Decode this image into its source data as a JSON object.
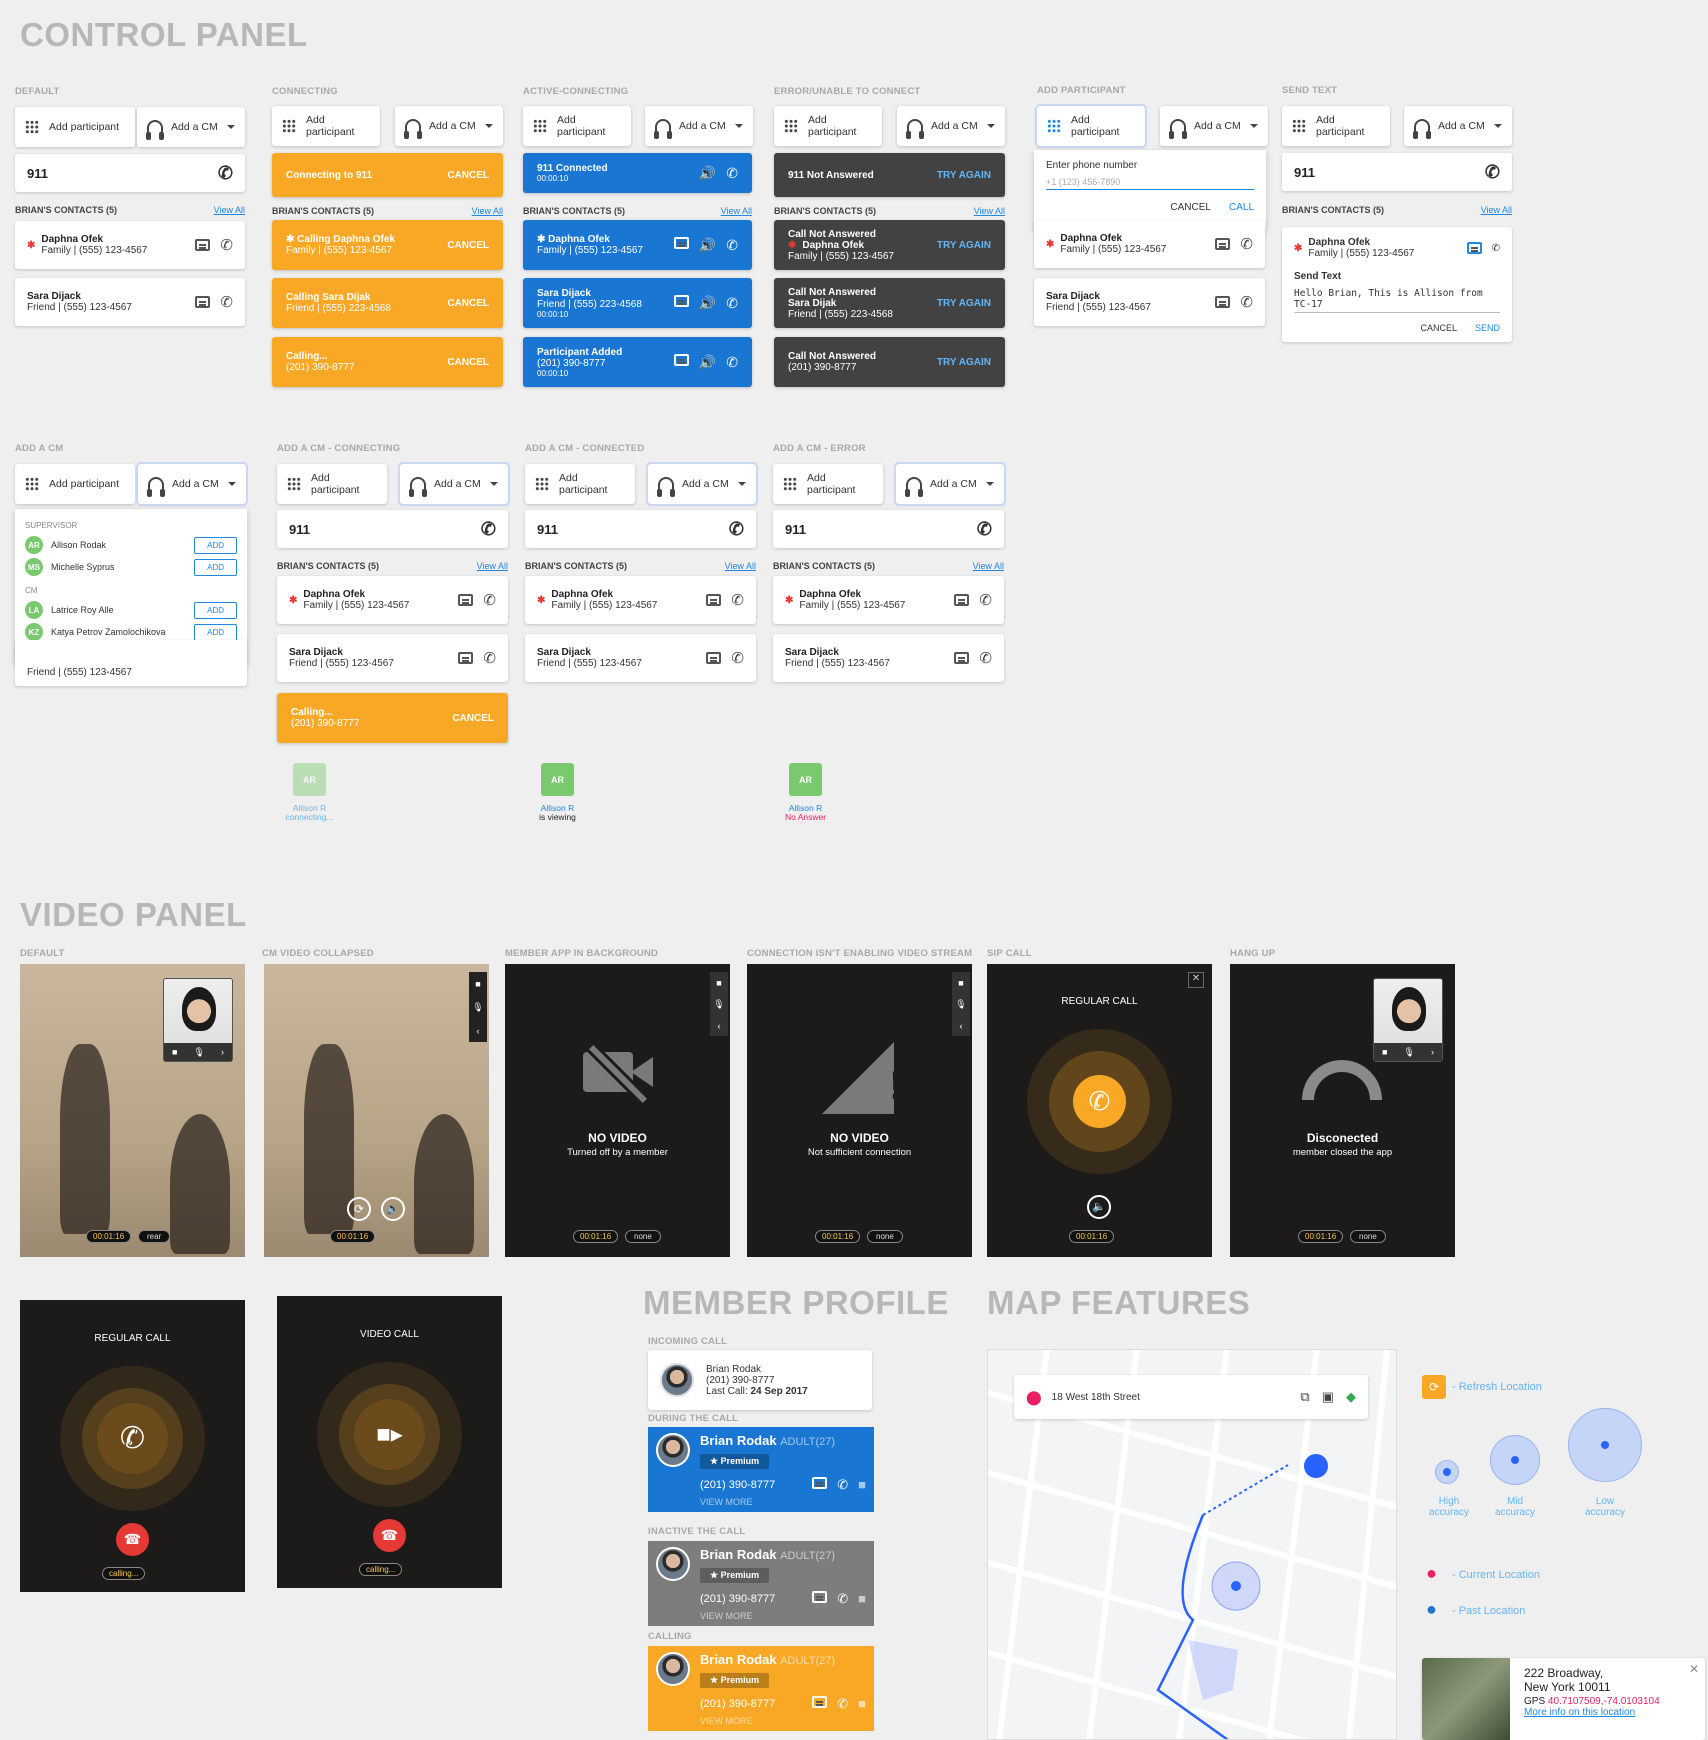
{
  "sections": {
    "control": "CONTROL PANEL",
    "video": "VIDEO PANEL",
    "member": "MEMBER PROFILE",
    "map": "MAP FEATURES"
  },
  "common": {
    "add_participant": "Add participant",
    "add_cm": "Add a CM",
    "number": "911",
    "contacts": "BRIAN'S CONTACTS",
    "count": "(5)",
    "view_all": "View All",
    "daphna": "Daphna Ofek",
    "daphna_sub": "Family | (555) 123-4567",
    "sara": "Sara Dijack",
    "sara_sub": "Friend | (555) 123-4567",
    "sara_sub2": "Friend | (555) 223-4568",
    "cancel": "CANCEL",
    "try_again": "TRY AGAIN",
    "time": "00:00:10"
  },
  "labels": {
    "default": "DEFAULT",
    "connecting": "CONNECTING",
    "active": "ACTIVE-CONNECTING",
    "error": "ERROR/UNABLE TO CONNECT",
    "add_part": "ADD PARTICIPANT",
    "send_text": "SEND TEXT",
    "add_cm": "ADD A CM",
    "cm_connecting": "ADD A CM - CONNECTING",
    "cm_connected": "ADD A CM - CONNECTED",
    "cm_error": "ADD A CM - ERROR"
  },
  "connecting": {
    "c1": "Connecting to 911",
    "c2": "Calling Daphna Ofek",
    "c3": "Calling Sara Dijak",
    "c4": "Calling...",
    "c4sub": "(201) 390-8777"
  },
  "active": {
    "a1": "911 Connected",
    "a2": "Daphna Ofek",
    "a3": "Sara Dijack",
    "a4": "Participant Added",
    "a4sub": "(201) 390-8777"
  },
  "error": {
    "e1": "911 Not Answered",
    "e2a": "Call Not Answered",
    "e2b": "Daphna Ofek",
    "e3a": "Call Not Answered",
    "e3b": "Sara Dijak",
    "e4a": "Call Not Answered",
    "e4b": "(201) 390-8777"
  },
  "addpart": {
    "enter": "Enter phone number",
    "placeholder": "+1 (123) 456-7890",
    "cancel": "CANCEL",
    "call": "CALL"
  },
  "sendtext": {
    "label": "Send Text",
    "value": "Hello Brian, This is Allison from TC-17",
    "cancel": "CANCEL",
    "send": "SEND"
  },
  "cmdrop": {
    "supervisor": "SUPERVISOR",
    "cm": "CM",
    "add": "ADD",
    "people": [
      {
        "ini": "AR",
        "name": "Allison Rodak"
      },
      {
        "ini": "MS",
        "name": "Michelle Syprus"
      },
      {
        "ini": "LA",
        "name": "Latrice Roy Alle"
      },
      {
        "ini": "KZ",
        "name": "Katya Petrov Zamolochikova"
      }
    ]
  },
  "cmstatus": {
    "ini": "AR",
    "name": "Allison R",
    "s1": "connecting...",
    "s2": "is viewing",
    "s3": "No Answer"
  },
  "video": {
    "l1": "DEFAULT",
    "l2": "CM VIDEO COLLAPSED",
    "l3": "MEMBER APP IN BACKGROUND",
    "l4": "CONNECTION ISN'T ENABLING VIDEO STREAM",
    "l5": "SIP call",
    "l6": "HANG UP",
    "timer": "00:01:16",
    "rear": "rear",
    "none": "none",
    "novideo": "NO VIDEO",
    "turned": "Turned off by a member",
    "notsuff": "Not sufficient connection",
    "regular": "REGULAR CALL",
    "videocall": "VIDEO CALL",
    "disc": "Disconected",
    "disc_sub": "member closed the app",
    "calling": "calling..."
  },
  "member": {
    "incoming": "INCOMING CALL",
    "during": "DURING THE CALL",
    "inactive": "INACTIVE THE CALL",
    "calling": "CALLING",
    "name": "Brian Rodak",
    "phone": "(201) 390-8777",
    "last": "Last Call:",
    "last_date": "24 Sep 2017",
    "age": "ADULT(27)",
    "premium": "Premium",
    "more": "VIEW MORE"
  },
  "map": {
    "address": "18 West 18th Street",
    "refresh": "- Refresh Location",
    "high": "High accuracy",
    "mid": "Mid accuracy",
    "low": "Low accuracy",
    "current": "- Current Location",
    "past": "- Past Location",
    "card_addr1": "222 Broadway,",
    "card_addr2": "New York 10011",
    "gps": "GPS",
    "gps_val": "40.7107509,-74.0103104",
    "more": "More info on this location"
  }
}
